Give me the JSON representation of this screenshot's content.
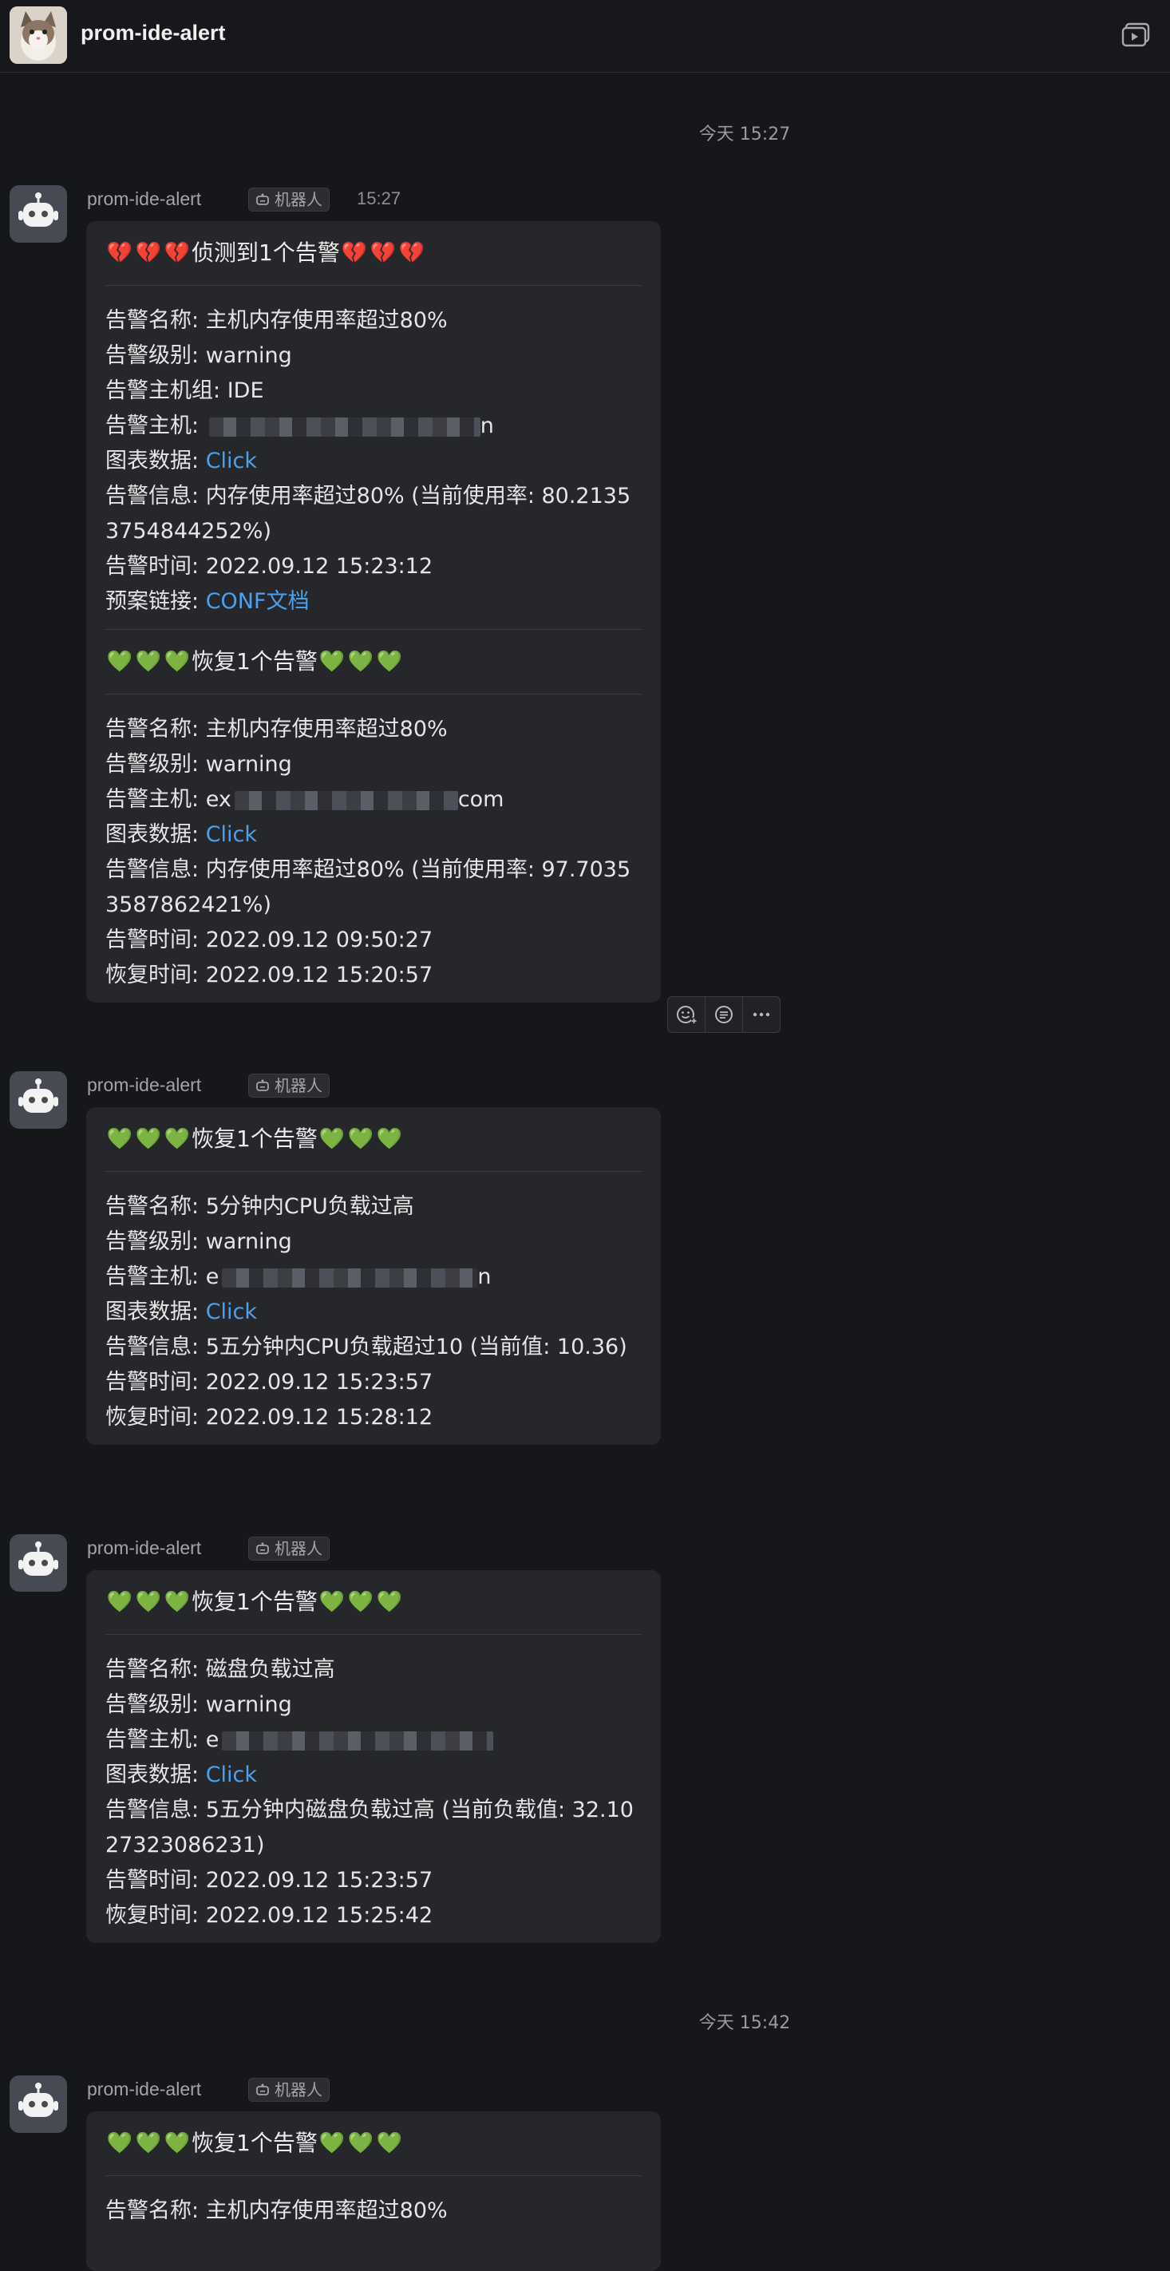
{
  "header": {
    "title": "prom-ide-alert",
    "avatar_icon": "cat-avatar",
    "action_icon": "video-window-icon"
  },
  "timestamps": [
    "今天 15:27",
    "今天 15:42"
  ],
  "bot_tag_label": "机器人",
  "sender_name": "prom-ide-alert",
  "first_message_time": "15:27",
  "messages": [
    {
      "sections": [
        {
          "title": "侦测到1个告警",
          "heart": "broken",
          "fields": [
            {
              "label": "告警名称",
              "value": "主机内存使用率超过80%"
            },
            {
              "label": "告警级别",
              "value": "warning"
            },
            {
              "label": "告警主机组",
              "value": "IDE"
            },
            {
              "label": "告警主机",
              "value": "",
              "tail": "n"
            },
            {
              "label": "图表数据",
              "value": "Click",
              "link": true
            },
            {
              "label": "告警信息",
              "value": "内存使用率超过80% (当前使用率: 80.21353754844252%)"
            },
            {
              "label": "告警时间",
              "value": "2022.09.12 15:23:12"
            },
            {
              "label": "预案链接",
              "value": "CONF文档",
              "link": true
            }
          ]
        },
        {
          "title": "恢复1个告警",
          "heart": "green",
          "fields": [
            {
              "label": "告警名称",
              "value": "主机内存使用率超过80%"
            },
            {
              "label": "告警级别",
              "value": "warning"
            },
            {
              "label": "告警主机",
              "value": "ex",
              "tail": "com"
            },
            {
              "label": "图表数据",
              "value": "Click",
              "link": true
            },
            {
              "label": "告警信息",
              "value": "内存使用率超过80% (当前使用率: 97.70353587862421%)"
            },
            {
              "label": "告警时间",
              "value": "2022.09.12 09:50:27"
            },
            {
              "label": "恢复时间",
              "value": "2022.09.12 15:20:57"
            }
          ]
        }
      ]
    },
    {
      "sections": [
        {
          "title": "恢复1个告警",
          "heart": "green",
          "fields": [
            {
              "label": "告警名称",
              "value": "5分钟内CPU负载过高"
            },
            {
              "label": "告警级别",
              "value": "warning"
            },
            {
              "label": "告警主机",
              "value": "e",
              "tail": "n"
            },
            {
              "label": "图表数据",
              "value": "Click",
              "link": true
            },
            {
              "label": "告警信息",
              "value": "5五分钟内CPU负载超过10 (当前值: 10.36)"
            },
            {
              "label": "告警时间",
              "value": "2022.09.12 15:23:57"
            },
            {
              "label": "恢复时间",
              "value": "2022.09.12 15:28:12"
            }
          ]
        }
      ]
    },
    {
      "sections": [
        {
          "title": "恢复1个告警",
          "heart": "green",
          "fields": [
            {
              "label": "告警名称",
              "value": "磁盘负载过高"
            },
            {
              "label": "告警级别",
              "value": "warning"
            },
            {
              "label": "告警主机",
              "value": "e",
              "tail": ""
            },
            {
              "label": "图表数据",
              "value": "Click",
              "link": true
            },
            {
              "label": "告警信息",
              "value": "5五分钟内磁盘负载过高 (当前负载值: 32.1027323086231)"
            },
            {
              "label": "告警时间",
              "value": "2022.09.12 15:23:57"
            },
            {
              "label": "恢复时间",
              "value": "2022.09.12 15:25:42"
            }
          ]
        }
      ]
    },
    {
      "sections": [
        {
          "title": "恢复1个告警",
          "heart": "green",
          "fields": [
            {
              "label": "告警名称",
              "value": "主机内存使用率超过80%"
            }
          ]
        }
      ]
    }
  ],
  "hover_actions": [
    "add-reaction-icon",
    "reply-thread-icon",
    "more-icon"
  ],
  "colors": {
    "background": "#16171a",
    "bubble": "#25272b",
    "link": "#4aa1f0",
    "broken_heart": "#e23a45",
    "green_heart": "#3cc43c"
  }
}
